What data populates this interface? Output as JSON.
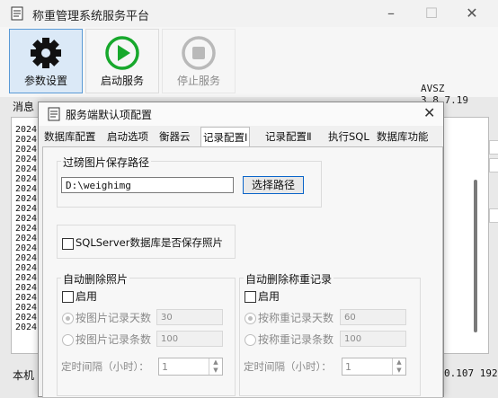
{
  "main": {
    "title": "称重管理系统服务平台",
    "toolbar": {
      "settings_label": "参数设置",
      "start_label": "启动服务",
      "stop_label": "停止服务"
    },
    "version": "AVSZ 3.8.7.19",
    "msg_label": "消息",
    "log_prefix": "2024",
    "status_left": "本机",
    "status_right": "0.107 192"
  },
  "dialog": {
    "title": "服务端默认项配置",
    "tabs": [
      "数据库配置",
      "启动选项",
      "衡器云",
      "记录配置Ⅰ",
      "记录配置Ⅱ",
      "执行SQL",
      "数据库功能"
    ],
    "active_tab": "记录配置Ⅰ",
    "path_group_label": "过磅图片保存路径",
    "path_value": "D:\\weighimg",
    "choose_path_button": "选择路径",
    "sqlserver_checkbox": "SQLServer数据库是否保存照片",
    "auto_delete_photos": {
      "label": "自动删除照片",
      "enable": "启用",
      "by_days": "按图片记录天数",
      "days_value": "30",
      "by_count": "按图片记录条数",
      "count_value": "100",
      "interval_label": "定时间隔（小时）：",
      "interval_value": "1"
    },
    "auto_delete_records": {
      "label": "自动删除称重记录",
      "enable": "启用",
      "by_days": "按称重记录天数",
      "days_value": "60",
      "by_count": "按称重记录条数",
      "count_value": "100",
      "interval_label": "定时间隔（小时）：",
      "interval_value": "1"
    }
  }
}
